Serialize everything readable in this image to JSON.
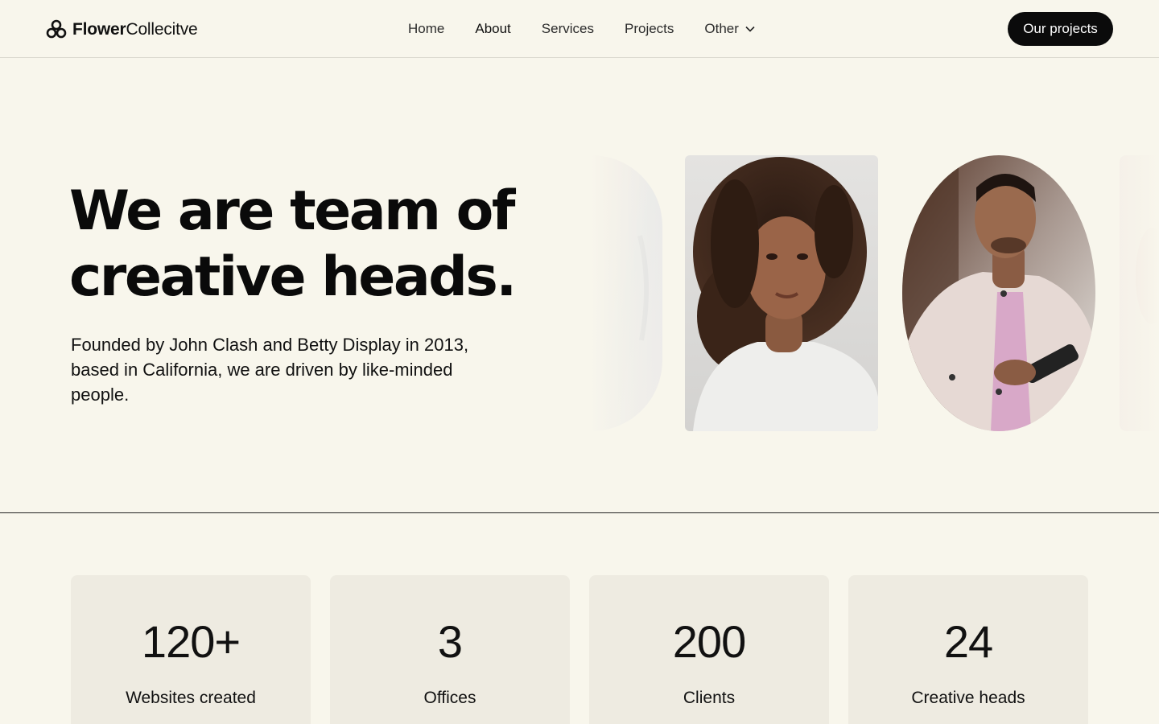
{
  "header": {
    "logo_bold": "Flower",
    "logo_light": "Collecitve",
    "nav": [
      {
        "label": "Home"
      },
      {
        "label": "About"
      },
      {
        "label": "Services"
      },
      {
        "label": "Projects"
      },
      {
        "label": "Other"
      }
    ],
    "cta_label": "Our projects"
  },
  "hero": {
    "title_line1": "We are team of",
    "title_line2": "creative heads.",
    "subtitle": "Founded by John Clash and Betty Display in 2013, based in California, we are driven by like-minded people."
  },
  "stats": [
    {
      "value": "120+",
      "label": "Websites created"
    },
    {
      "value": "3",
      "label": "Offices"
    },
    {
      "value": "200",
      "label": "Clients"
    },
    {
      "value": "24",
      "label": "Creative heads"
    }
  ],
  "colors": {
    "background": "#f8f6ec",
    "card": "#eeebe1",
    "button": "#0b0b0b"
  },
  "icons": {
    "logo": "flower-icon",
    "dropdown": "chevron-down-icon"
  }
}
